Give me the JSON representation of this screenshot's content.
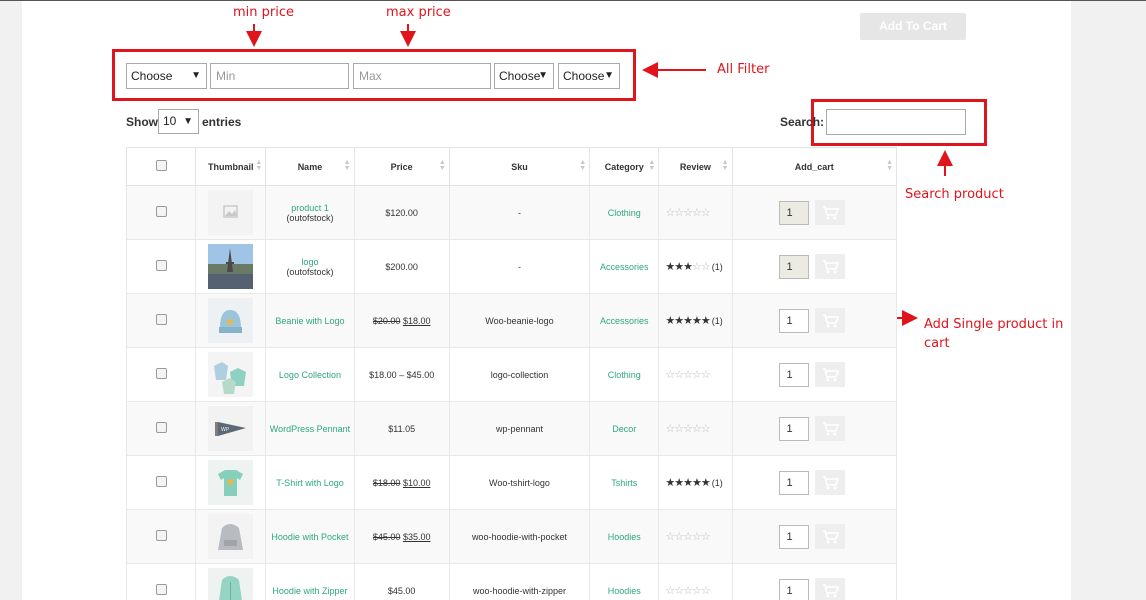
{
  "toolbar": {
    "add_to_cart_label": "Add To Cart"
  },
  "annotations": {
    "min_price": "min price",
    "max_price": "max price",
    "all_filter": "All Filter",
    "search_product": "Search product",
    "add_single_line1": "Add Single product in",
    "add_single_line2": "cart"
  },
  "filters": {
    "category_select": "Choose",
    "min_placeholder": "Min",
    "max_placeholder": "Max",
    "select_2": "Choose",
    "select_3": "Choose"
  },
  "entries": {
    "show_label": "Show",
    "value": "10",
    "suffix": "entries"
  },
  "search": {
    "label": "Search:",
    "value": ""
  },
  "table": {
    "headers": [
      "Thumbnail",
      "Name",
      "Price",
      "Sku",
      "Category",
      "Review",
      "Add_cart"
    ],
    "rows": [
      {
        "name": "product 1",
        "status": "(outofstock)",
        "price": "$120.00",
        "sku": "-",
        "category": "Clothing",
        "rating": 0,
        "review_count": "",
        "qty": "1",
        "qty_disabled": true,
        "thumb": "placeholder"
      },
      {
        "name": "logo",
        "status": "(outofstock)",
        "price": "$200.00",
        "sku": "-",
        "category": "Accessories",
        "rating": 3,
        "review_count": "(1)",
        "qty": "1",
        "qty_disabled": true,
        "thumb": "eiffel"
      },
      {
        "name": "Beanie with Logo",
        "status": "",
        "price_old": "$20.00",
        "price": "$18.00",
        "sku": "Woo-beanie-logo",
        "category": "Accessories",
        "rating": 5,
        "review_count": "(1)",
        "qty": "1",
        "qty_disabled": false,
        "thumb": "beanie"
      },
      {
        "name": "Logo Collection",
        "status": "",
        "price": "$18.00 – $45.00",
        "sku": "logo-collection",
        "category": "Clothing",
        "rating": 0,
        "review_count": "",
        "qty": "1",
        "qty_disabled": false,
        "thumb": "collection"
      },
      {
        "name": "WordPress Pennant",
        "status": "",
        "price": "$11.05",
        "sku": "wp-pennant",
        "category": "Decor",
        "rating": 0,
        "review_count": "",
        "qty": "1",
        "qty_disabled": false,
        "thumb": "pennant"
      },
      {
        "name": "T-Shirt with Logo",
        "status": "",
        "price_old": "$18.00",
        "price": "$10.00",
        "sku": "Woo-tshirt-logo",
        "category": "Tshirts",
        "rating": 5,
        "review_count": "(1)",
        "qty": "1",
        "qty_disabled": false,
        "thumb": "tshirt"
      },
      {
        "name": "Hoodie with Pocket",
        "status": "",
        "price_old": "$45.00",
        "price": "$35.00",
        "sku": "woo-hoodie-with-pocket",
        "category": "Hoodies",
        "rating": 0,
        "review_count": "",
        "qty": "1",
        "qty_disabled": false,
        "thumb": "hoodie-gray"
      },
      {
        "name": "Hoodie with Zipper",
        "status": "",
        "price": "$45.00",
        "sku": "woo-hoodie-with-zipper",
        "category": "Hoodies",
        "rating": 0,
        "review_count": "",
        "qty": "1",
        "qty_disabled": false,
        "thumb": "hoodie-green"
      }
    ]
  },
  "colors": {
    "annotation": "#e0141c",
    "link": "#2ea77b",
    "button_disabled": "#e6e6e6"
  }
}
